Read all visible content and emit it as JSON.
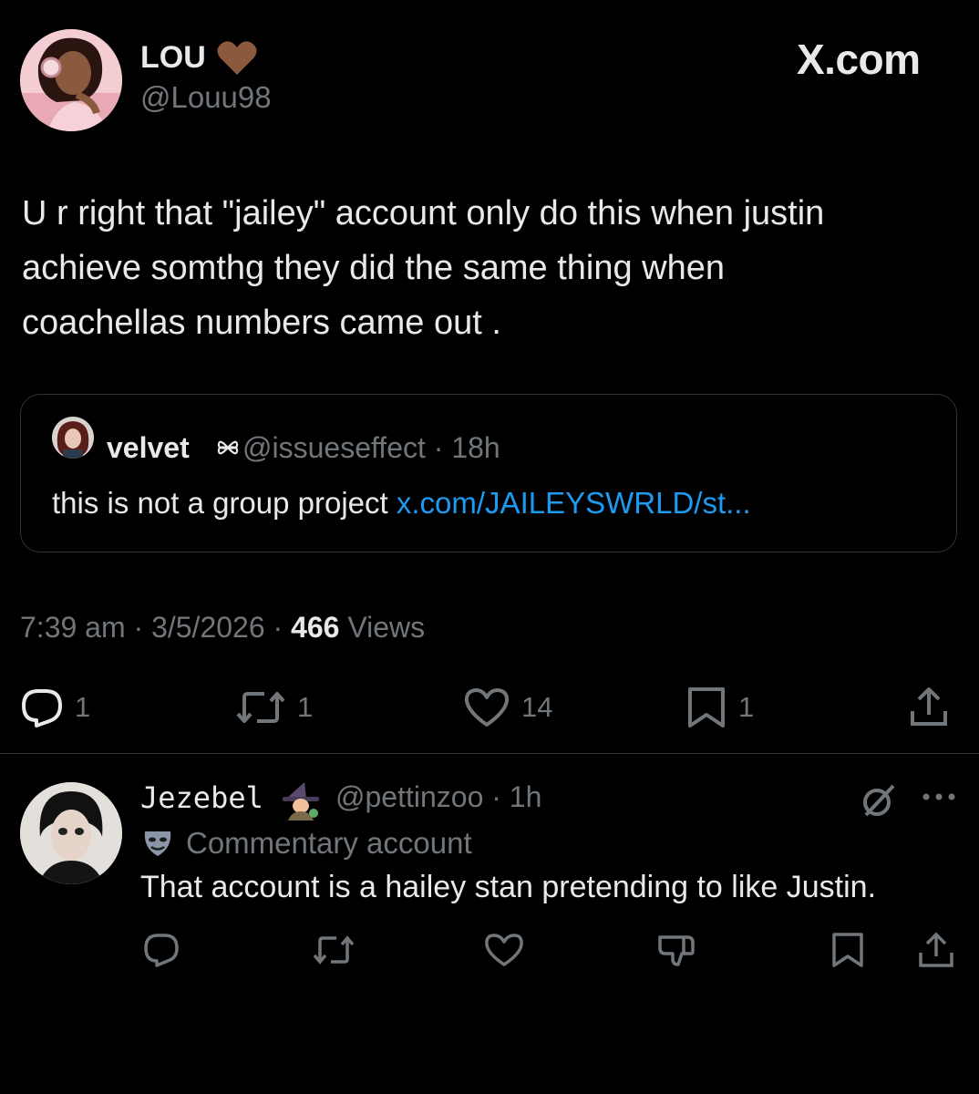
{
  "tweet": {
    "author_name": "LOU",
    "author_handle": "@Louu98",
    "site_label": "X.com",
    "text_lines": [
      "U r right  that \"jailey\" account  only do this when justin",
      "achieve somthg  they did the same thing when",
      "coachellas numbers came out ."
    ],
    "quote": {
      "name": "velvet",
      "handle_time": "@issueseffect · 18h",
      "text": "this is not a group project ",
      "link": "x.com/JAILEYSWRLD/st..."
    },
    "time": "7:39 am",
    "date": "3/5/2026",
    "views_count": "466",
    "views_label": "Views",
    "replies": "1",
    "retweets": "1",
    "likes": "14",
    "bookmarks": "1"
  },
  "reply": {
    "name": "Jezebel",
    "handle_time": "@pettinzoo · 1h",
    "label": "Commentary account",
    "text": "That account is a hailey stan pretending to like Justin."
  },
  "colors": {
    "background": "#000000",
    "text": "#e7e9ea",
    "muted": "#71767b",
    "link": "#1d9bf0",
    "border": "#2f3336",
    "heart_badge": "#8b5a3c"
  },
  "icons": [
    "reply-icon",
    "retweet-icon",
    "like-icon",
    "bookmark-icon",
    "share-icon",
    "grok-icon",
    "more-icon",
    "dislike-icon",
    "mask-icon",
    "heart-badge-icon"
  ]
}
